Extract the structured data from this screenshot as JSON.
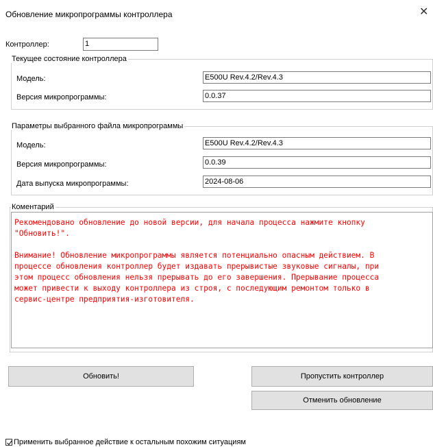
{
  "window": {
    "title": "Обновление микропрограммы контроллера",
    "close_glyph": "✕"
  },
  "controller": {
    "label": "Контроллер:",
    "value": "1"
  },
  "current_state": {
    "legend": "Текущее состояние контроллера",
    "model_label": "Модель:",
    "model_value": "E500U Rev.4.2/Rev.4.3",
    "version_label": "Версия микропрограммы:",
    "version_value": "0.0.37"
  },
  "selected_file": {
    "legend": "Параметры выбранного файла микропрограммы",
    "model_label": "Модель:",
    "model_value": "E500U Rev.4.2/Rev.4.3",
    "version_label": "Версия микропрограммы:",
    "version_value": "0.0.39",
    "date_label": "Дата выпуска микропрограммы:",
    "date_value": "2024-08-06"
  },
  "comment": {
    "legend": "Коментарий",
    "text": "Рекомендовано обновление до новой версии, для начала процесса нажмите кнопку\n\"Обновить!\".\n\nВнимание! Обновление микропрограммы является потенциально опасным действием. В\nпроцессе обновления контроллер будет издавать прерывистые звуковые сигналы, при\nэтом процесс обновления нельзя прерывать до его завершения. Прерывание процесса\nможет привести к выходу контроллера из строя, с последующим ремонтом только в\nсервис-центре предприятия-изготовителя.",
    "text_color": "#ff0000"
  },
  "buttons": {
    "update": "Обновить!",
    "skip": "Пропустить контроллер",
    "cancel": "Отменить обновление"
  },
  "apply_all": {
    "label": "Применить выбранное действие к остальным похожим ситуациям",
    "checked": true
  }
}
